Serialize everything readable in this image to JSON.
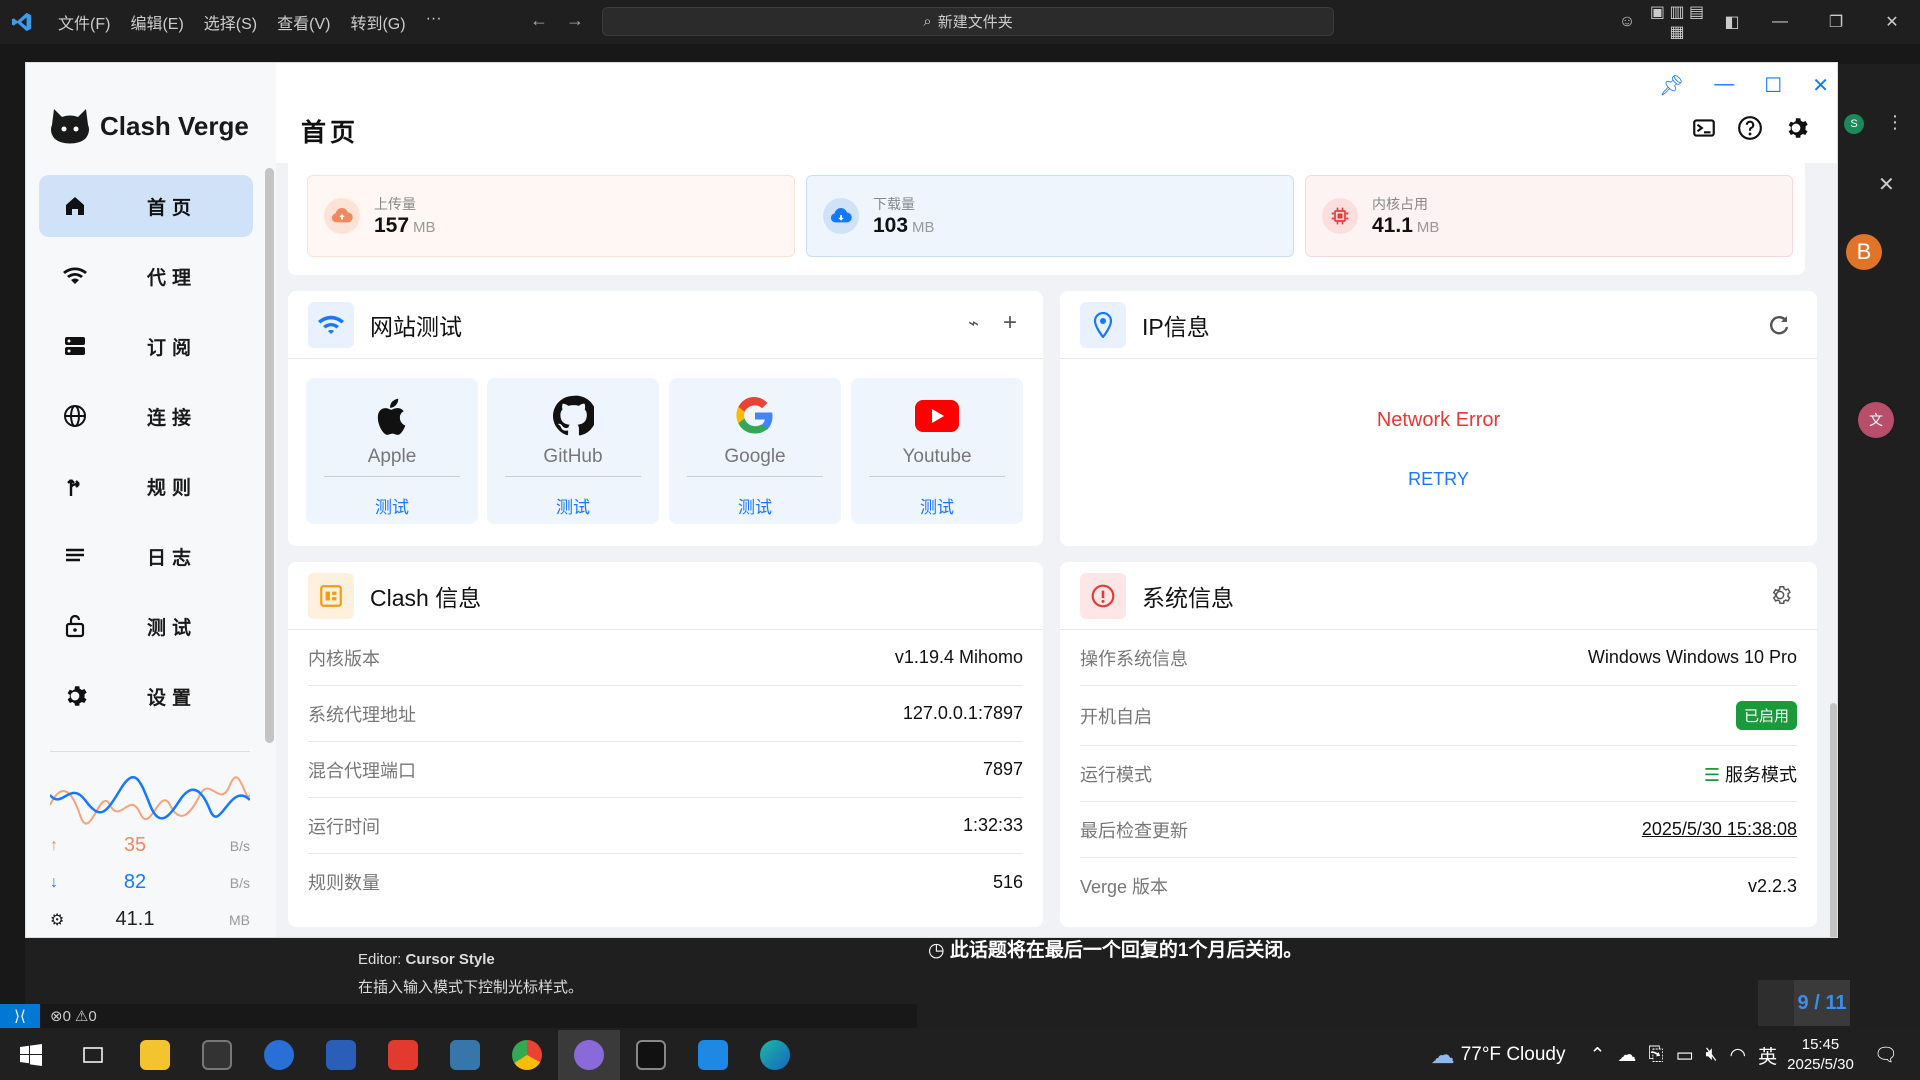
{
  "vscode": {
    "menu": [
      "文件(F)",
      "编辑(E)",
      "选择(S)",
      "查看(V)",
      "转到(G)",
      "···"
    ],
    "search": "新建文件夹",
    "status_problems": "0",
    "status_warnings": "0",
    "footer_title_prefix": "Editor: ",
    "footer_title_bold": "Cursor Style",
    "footer_desc": "在插入输入模式下控制光标样式。",
    "close_note": "此话题将在最后一个回复的1个月后关闭。",
    "page_indicator": "9 / 11"
  },
  "app": {
    "name": "Clash Verge",
    "page_title": "首页",
    "nav": [
      {
        "label": "首页",
        "icon": "home-icon",
        "active": true
      },
      {
        "label": "代理",
        "icon": "wifi-icon"
      },
      {
        "label": "订阅",
        "icon": "storage-icon"
      },
      {
        "label": "连接",
        "icon": "globe-icon"
      },
      {
        "label": "规则",
        "icon": "fork-icon"
      },
      {
        "label": "日志",
        "icon": "log-icon"
      },
      {
        "label": "测试",
        "icon": "lock-icon"
      },
      {
        "label": "设置",
        "icon": "gear-icon"
      }
    ],
    "traffic": {
      "up_value": "35",
      "up_unit": "B/s",
      "down_value": "82",
      "down_unit": "B/s",
      "mem_value": "41.1",
      "mem_unit": "MB"
    },
    "stats": {
      "upload": {
        "label": "上传量",
        "value": "157",
        "unit": "MB"
      },
      "download": {
        "label": "下载量",
        "value": "103",
        "unit": "MB"
      },
      "memory": {
        "label": "内核占用",
        "value": "41.1",
        "unit": "MB"
      }
    },
    "site_test": {
      "title": "网站测试",
      "sites": [
        {
          "name": "Apple",
          "action": "测试"
        },
        {
          "name": "GitHub",
          "action": "测试"
        },
        {
          "name": "Google",
          "action": "测试"
        },
        {
          "name": "Youtube",
          "action": "测试"
        }
      ]
    },
    "ip_info": {
      "title": "IP信息",
      "error": "Network Error",
      "retry": "RETRY"
    },
    "clash_info": {
      "title": "Clash 信息",
      "rows": [
        {
          "k": "内核版本",
          "v": "v1.19.4 Mihomo"
        },
        {
          "k": "系统代理地址",
          "v": "127.0.0.1:7897"
        },
        {
          "k": "混合代理端口",
          "v": "7897"
        },
        {
          "k": "运行时间",
          "v": "1:32:33"
        },
        {
          "k": "规则数量",
          "v": "516"
        }
      ]
    },
    "system_info": {
      "title": "系统信息",
      "os_label": "操作系统信息",
      "os_value": "Windows Windows 10 Pro",
      "autostart_label": "开机自启",
      "autostart_value": "已启用",
      "mode_label": "运行模式",
      "mode_value": "服务模式",
      "update_label": "最后检查更新",
      "update_value": "2025/5/30 15:38:08",
      "version_label": "Verge 版本",
      "version_value": "v2.2.3"
    }
  },
  "taskbar": {
    "weather": "77°F  Cloudy",
    "ime": "英",
    "time": "15:45",
    "date": "2025/5/30"
  },
  "colors": {
    "accent": "#1677ff",
    "upload": "#f08a5d",
    "download": "#1677ff",
    "memory": "#e53935",
    "success": "#1a9a3a"
  }
}
